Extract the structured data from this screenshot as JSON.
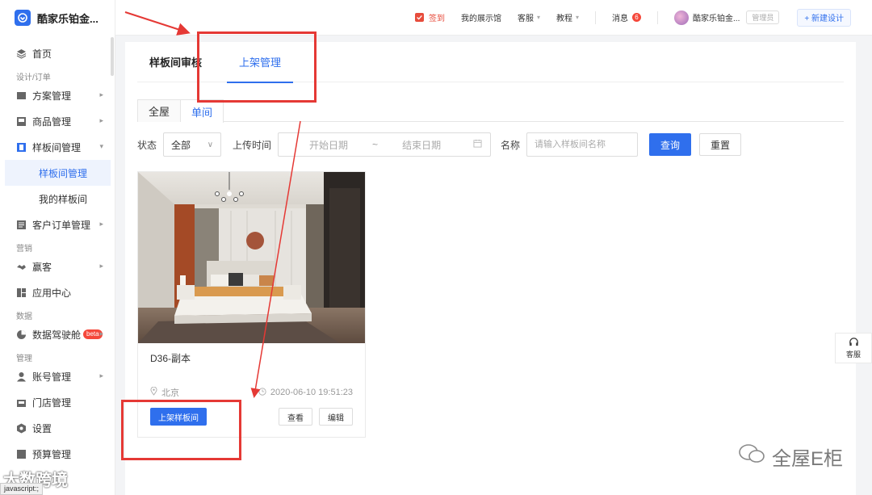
{
  "app": {
    "title": "酷家乐铂金..."
  },
  "sidebar": {
    "home": "首页",
    "section_design": "设计/订单",
    "scheme": "方案管理",
    "goods": "商品管理",
    "sample_room": "样板间管理",
    "sub_sample_room_manage": "样板间管理",
    "sub_my_sample_room": "我的样板间",
    "customer_order": "客户订单管理",
    "section_marketing": "营销",
    "winner": "赢客",
    "app_center": "应用中心",
    "section_data": "数据",
    "data_cockpit": "数据驾驶舱",
    "beta": "beta",
    "section_manage": "管理",
    "account": "账号管理",
    "store": "门店管理",
    "settings": "设置",
    "budget": "预算管理"
  },
  "topbar": {
    "signin": "签到",
    "showroom": "我的展示馆",
    "service": "客服",
    "tutorial": "教程",
    "message": "消息",
    "message_count": "6",
    "username": "酷家乐铂金...",
    "role": "管理员",
    "new_design": "+ 新建设计"
  },
  "tabs": {
    "review": "样板间审核",
    "shelf": "上架管理"
  },
  "subtabs": {
    "whole": "全屋",
    "single": "单间"
  },
  "filters": {
    "status_label": "状态",
    "status_value": "全部",
    "upload_label": "上传时间",
    "start_date": "开始日期",
    "tilde": "~",
    "end_date": "结束日期",
    "name_label": "名称",
    "name_placeholder": "请输入样板间名称",
    "query": "查询",
    "reset": "重置"
  },
  "card": {
    "title": "D36-副本",
    "location": "北京",
    "time": "2020-06-10 19:51:23",
    "publish": "上架样板间",
    "view": "查看",
    "edit": "编辑"
  },
  "float_service": "客服",
  "watermark": "全屋E柜",
  "watermark2": "大数跨境",
  "status_bar": "javascript:;",
  "colors": {
    "primary": "#2f6fed",
    "annotation_red": "#e53935",
    "danger": "#f5483b"
  }
}
